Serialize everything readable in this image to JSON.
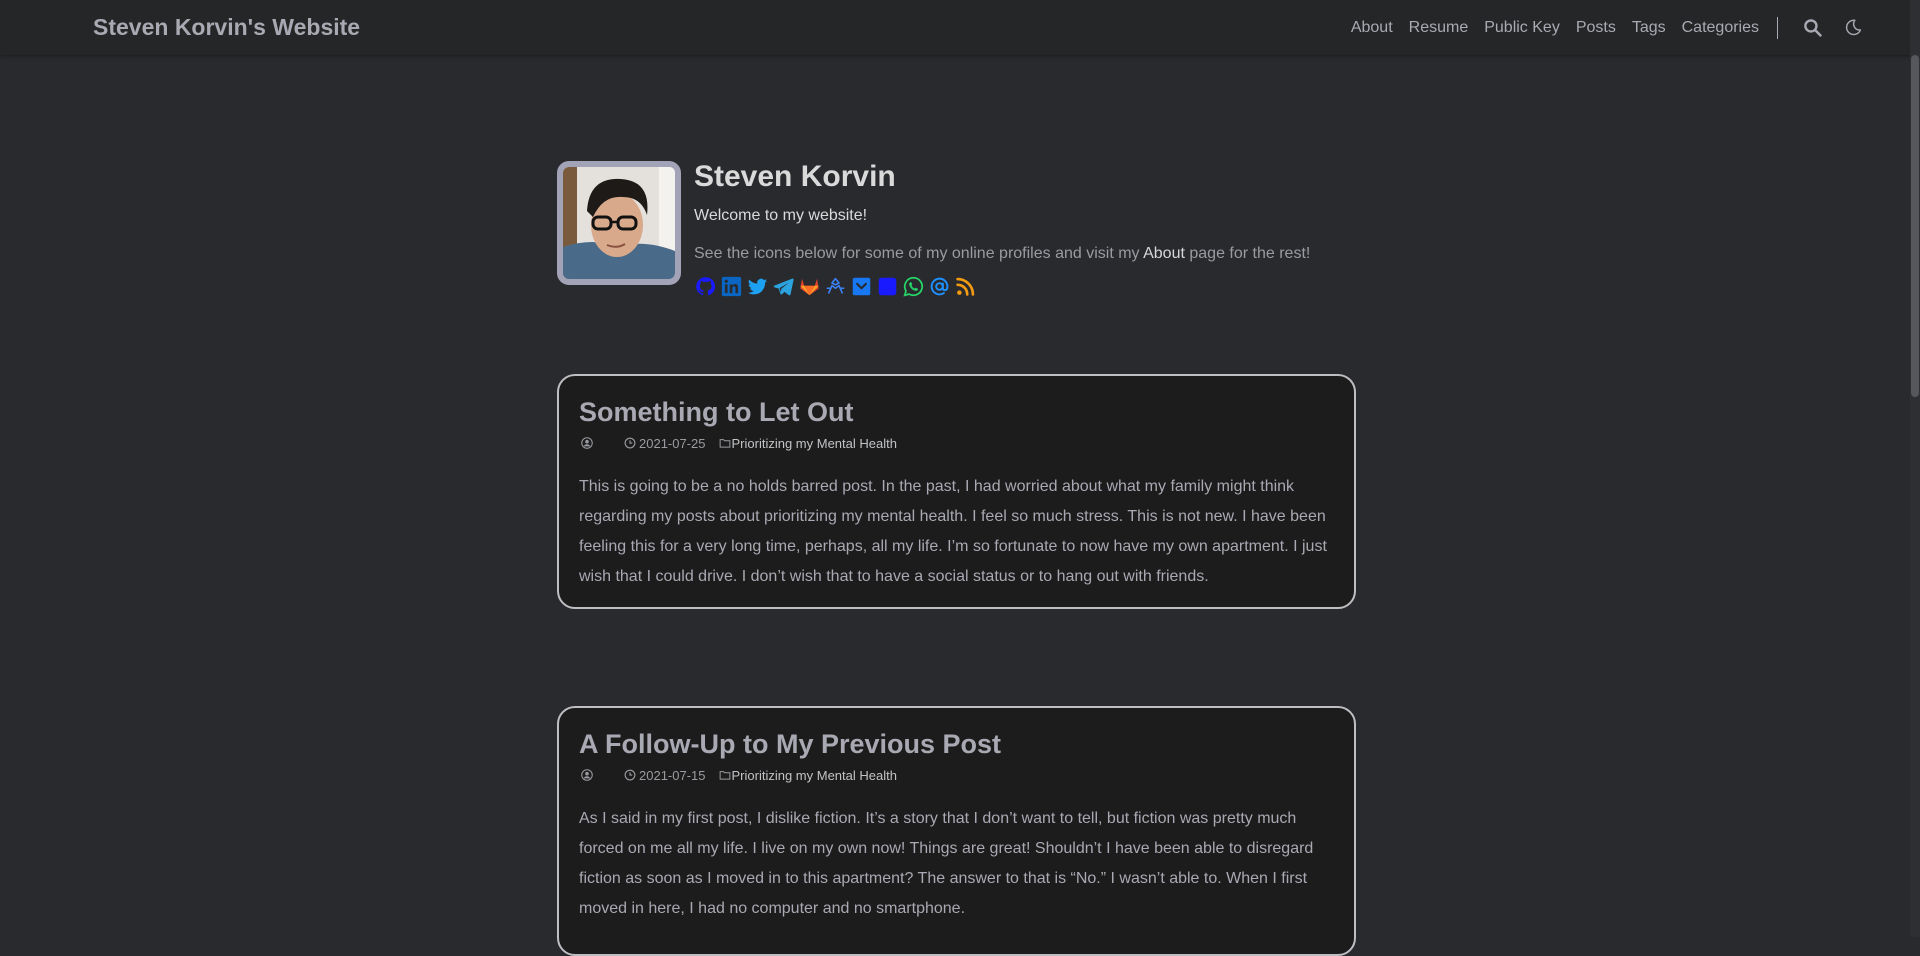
{
  "site": {
    "brand": "Steven Korvin's Website",
    "menu": [
      {
        "label": "About"
      },
      {
        "label": "Resume"
      },
      {
        "label": "Public Key"
      },
      {
        "label": "Posts"
      },
      {
        "label": "Tags"
      },
      {
        "label": "Categories"
      }
    ],
    "icons": {
      "search": "search-icon",
      "theme": "moon-icon"
    }
  },
  "profile": {
    "name": "Steven Korvin",
    "welcome": "Welcome to my website!",
    "intro_before": "See the icons below for some of my online profiles and visit my ",
    "intro_link": "About",
    "intro_after": " page for the rest!",
    "social": [
      {
        "name": "github-icon",
        "color": "#1a1aff"
      },
      {
        "name": "linkedin-icon",
        "color": "#0a66c2"
      },
      {
        "name": "twitter-icon",
        "color": "#1da1f2"
      },
      {
        "name": "telegram-icon",
        "color": "#2aa3df"
      },
      {
        "name": "gitlab-icon",
        "color": "#e2432a"
      },
      {
        "name": "liberapay-icon",
        "color": "#3b82f6"
      },
      {
        "name": "pocket-icon",
        "color": "#1877f2"
      },
      {
        "name": "square-icon",
        "color": "#1a1aff"
      },
      {
        "name": "whatsapp-icon",
        "color": "#25d366"
      },
      {
        "name": "email-icon",
        "color": "#1e90ff"
      },
      {
        "name": "rss-icon",
        "color": "#f39c12"
      }
    ]
  },
  "posts": [
    {
      "title": "Something to Let Out",
      "date": "2021-07-25",
      "category": "Prioritizing my Mental Health",
      "summary": "This is going to be a no holds barred post. In the past, I had worried about what my family might think regarding my posts about prioritizing my mental health. I feel so much stress. This is not new. I have been feeling this for a very long time, perhaps, all my life. I’m so fortunate to now have my own apartment. I just wish that I could drive. I don’t wish that to have a social status or to hang out with friends."
    },
    {
      "title": "A Follow-Up to My Previous Post",
      "date": "2021-07-15",
      "category": "Prioritizing my Mental Health",
      "summary": "As I said in my first post, I dislike fiction. It’s a story that I don’t want to tell, but fiction was pretty much forced on me all my life. I live on my own now! Things are great! Shouldn’t I have been able to disregard fiction as soon as I moved in to this apartment? The answer to that is “No.” I wasn’t able to. When I first moved in here, I had no computer and no smartphone."
    }
  ],
  "colors": {
    "background": "#292a2d",
    "navbar": "#252627",
    "card": "#1c1c1c",
    "text": "#a9a9b3"
  }
}
